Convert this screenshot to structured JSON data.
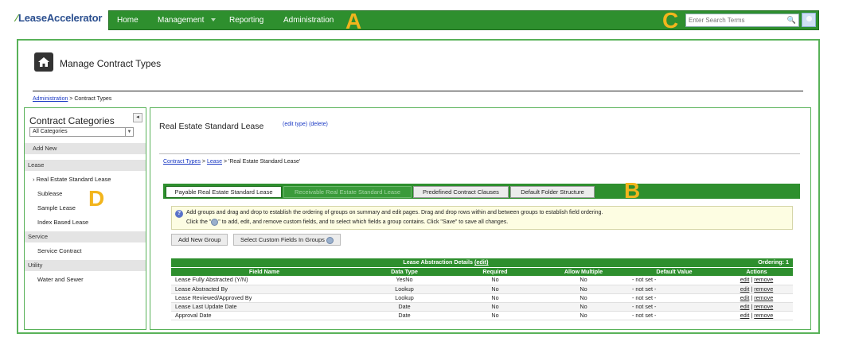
{
  "app": {
    "logo_text": "LeaseAccelerator",
    "logo_mark": "⁄"
  },
  "nav": {
    "items": [
      "Home",
      "Management",
      "Reporting",
      "Administration"
    ],
    "search_placeholder": "Enter Search Terms"
  },
  "callouts": {
    "a": "A",
    "b": "B",
    "c": "C",
    "d": "D"
  },
  "page": {
    "title": "Manage Contract Types",
    "breadcrumb_link": "Administration",
    "breadcrumb_sep": " > ",
    "breadcrumb_current": "Contract Types"
  },
  "sidebar": {
    "title": "Contract Categories",
    "collapse": "◂",
    "select_value": "All Categories",
    "add_new": "Add New",
    "groups": [
      {
        "label": "Lease",
        "items": [
          "Real Estate Standard Lease",
          "Sublease",
          "Sample Lease",
          "Index Based Lease"
        ]
      },
      {
        "label": "Service",
        "items": [
          "Service Contract"
        ]
      },
      {
        "label": "Utility",
        "items": [
          "Water and Sewer"
        ]
      }
    ],
    "selected_marker": "›"
  },
  "contract": {
    "title": "Real Estate Standard Lease",
    "edit_type": "(edit type)",
    "delete": "(delete)",
    "bc_link1": "Contract Types",
    "bc_sep": " > ",
    "bc_link2": "Lease",
    "bc_current": " > 'Real Estate Standard Lease'"
  },
  "tabs": [
    "Payable Real Estate Standard Lease",
    "Receivable Real Estate Standard Lease",
    "Predefined Contract Clauses",
    "Default Folder Structure"
  ],
  "info": {
    "line1": "Add groups and drag and drop to establish the ordering of groups on summary and edit pages. Drag and drop rows within and between groups to establish field ordering.",
    "line2_pre": "Click the \"",
    "line2_post": "\" to add, edit, and remove custom fields, and to select which fields a group contains. Click \"Save\" to save all changes."
  },
  "buttons": {
    "add_group": "Add New Group",
    "select_fields": "Select Custom Fields In Groups"
  },
  "table": {
    "caption": "Lease Abstraction Details",
    "caption_edit": "(edit)",
    "ordering": "Ordering: 1",
    "columns": [
      "Field Name",
      "Data Type",
      "Required",
      "Allow Multiple",
      "Default Value",
      "Actions"
    ],
    "rows": [
      [
        "Lease Fully Abstracted (Y/N)",
        "YesNo",
        "No",
        "No",
        "- not set -"
      ],
      [
        "Lease Abstracted By",
        "Lookup",
        "No",
        "No",
        "- not set -"
      ],
      [
        "Lease Reviewed/Approved By",
        "Lookup",
        "No",
        "No",
        "- not set -"
      ],
      [
        "Lease Last Update Date",
        "Date",
        "No",
        "No",
        "- not set -"
      ],
      [
        "Approval Date",
        "Date",
        "No",
        "No",
        "- not set -"
      ]
    ],
    "action_edit": "edit",
    "action_sep": " | ",
    "action_remove": "remove"
  }
}
